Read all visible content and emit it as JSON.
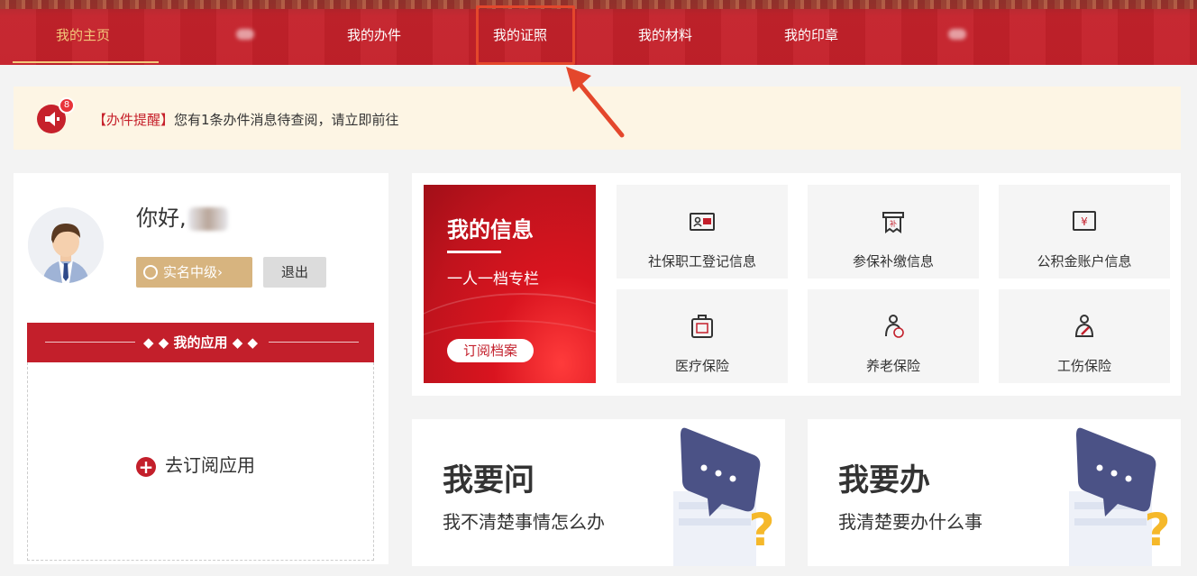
{
  "nav": {
    "items": [
      {
        "label": "我的主页",
        "active": true
      },
      {
        "label": "我的办件",
        "active": false
      },
      {
        "label": "我的证照",
        "active": false
      },
      {
        "label": "我的材料",
        "active": false
      },
      {
        "label": "我的印章",
        "active": false
      }
    ],
    "active_color": "#f3c87a",
    "background": "#c4202a",
    "highlight_color": "#e4472c"
  },
  "reminder": {
    "badge": "8",
    "tag": "【办件提醒】",
    "text": "您有1条办件消息待查阅，请立即前往"
  },
  "profile": {
    "greeting": "你好,",
    "verify_label": "实名中级",
    "verify_arrow": "›",
    "logout_label": "退出"
  },
  "apps": {
    "title": "我的应用",
    "subscribe_label": "去订阅应用"
  },
  "info": {
    "title": "我的信息",
    "subtitle": "一人一档专栏",
    "subscribe_label": "订阅档案",
    "tiles": [
      {
        "label": "社保职工登记信息",
        "icon": "id-card-icon"
      },
      {
        "label": "参保补缴信息",
        "icon": "receipt-icon"
      },
      {
        "label": "公积金账户信息",
        "icon": "yuan-card-icon"
      },
      {
        "label": "医疗保险",
        "icon": "medical-case-icon"
      },
      {
        "label": "养老保险",
        "icon": "elder-person-icon"
      },
      {
        "label": "工伤保险",
        "icon": "injury-person-icon"
      }
    ]
  },
  "cards": [
    {
      "title": "我要问",
      "subtitle": "我不清楚事情怎么办"
    },
    {
      "title": "我要办",
      "subtitle": "我清楚要办什么事"
    }
  ],
  "colors": {
    "brand_red": "#c31f2b",
    "gold": "#d7b47f",
    "reminder_bg": "#fdf5e4"
  }
}
